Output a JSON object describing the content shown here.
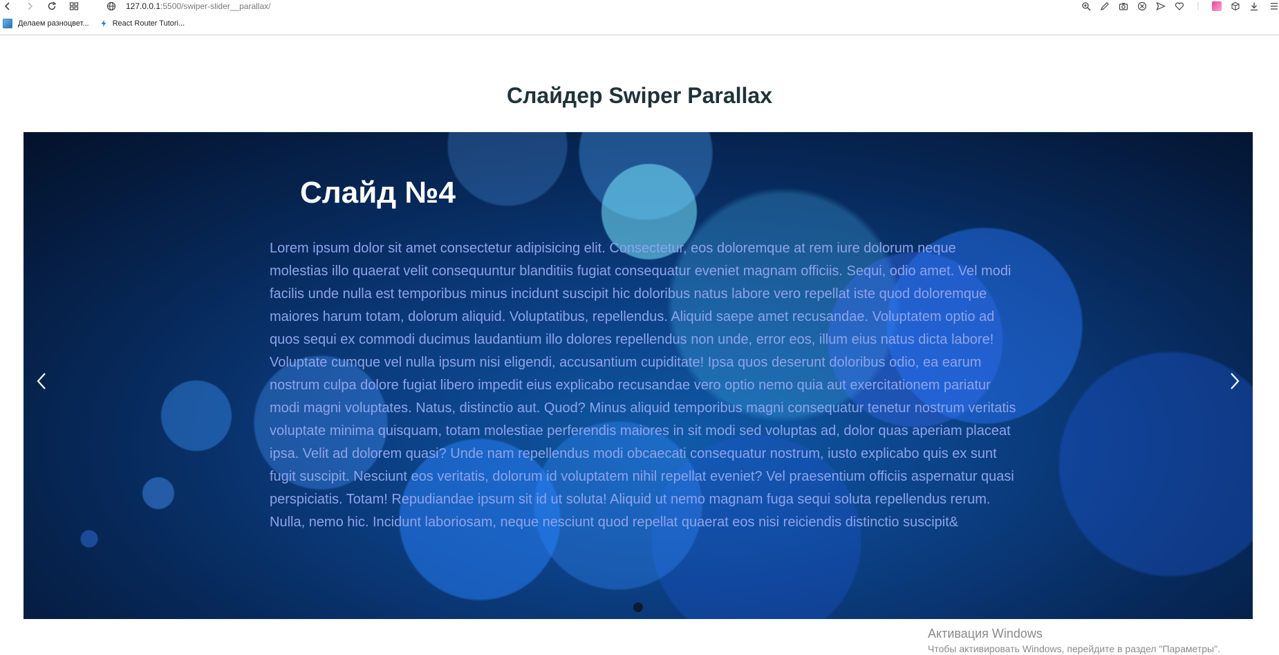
{
  "browser": {
    "url_host": "127.0.0.1",
    "url_rest": ":5500/swiper-slider__parallax/",
    "bookmarks": [
      {
        "label": "Делаем разноцвет..."
      },
      {
        "label": "React Router Tutori..."
      }
    ]
  },
  "page": {
    "title": "Слайдер Swiper Parallax"
  },
  "slider": {
    "slide_title": "Слайд №4",
    "slide_text": "Lorem ipsum dolor sit amet consectetur adipisicing elit. Consectetur, eos doloremque at rem iure dolorum neque molestias illo quaerat velit consequuntur blanditiis fugiat consequatur eveniet magnam officiis. Sequi, odio amet. Vel modi facilis unde nulla est temporibus minus incidunt suscipit hic doloribus natus labore vero repellat iste quod doloremque maiores harum totam, dolorum aliquid. Voluptatibus, repellendus. Aliquid saepe amet recusandae. Voluptatem optio ad quos sequi ex commodi ducimus laudantium illo dolores repellendus non unde, error eos, illum eius natus dicta labore! Voluptate cumque vel nulla ipsum nisi eligendi, accusantium cupiditate! Ipsa quos deserunt doloribus odio, ea earum nostrum culpa dolore fugiat libero impedit eius explicabo recusandae vero optio nemo quia aut exercitationem pariatur modi magni voluptates. Natus, distinctio aut. Quod? Minus aliquid temporibus magni consequatur tenetur nostrum veritatis voluptate minima quisquam, totam molestiae perferendis maiores in sit modi sed voluptas ad, dolor quas aperiam placeat ipsa. Velit ad dolorem quasi? Unde nam repellendus modi obcaecati consequatur nostrum, iusto explicabo quis ex sunt fugit suscipit. Nesciunt eos veritatis, dolorum id voluptatem nihil repellat eveniet? Vel praesentium officiis aspernatur quasi perspiciatis. Totam! Repudiandae ipsum sit id ut soluta! Aliquid ut nemo magnam fuga sequi soluta repellendus rerum. Nulla, nemo hic. Incidunt laboriosam, neque nesciunt quod repellat quaerat eos nisi reiciendis distinctio suscipit&",
    "prev_icon": "chevron-left-icon",
    "next_icon": "chevron-right-icon",
    "arrow_color": "#ffffff",
    "text_color": "#8ea3ea"
  },
  "os_overlay": {
    "title": "Активация Windows",
    "subtitle": "Чтобы активировать Windows, перейдите в раздел \"Параметры\"."
  }
}
